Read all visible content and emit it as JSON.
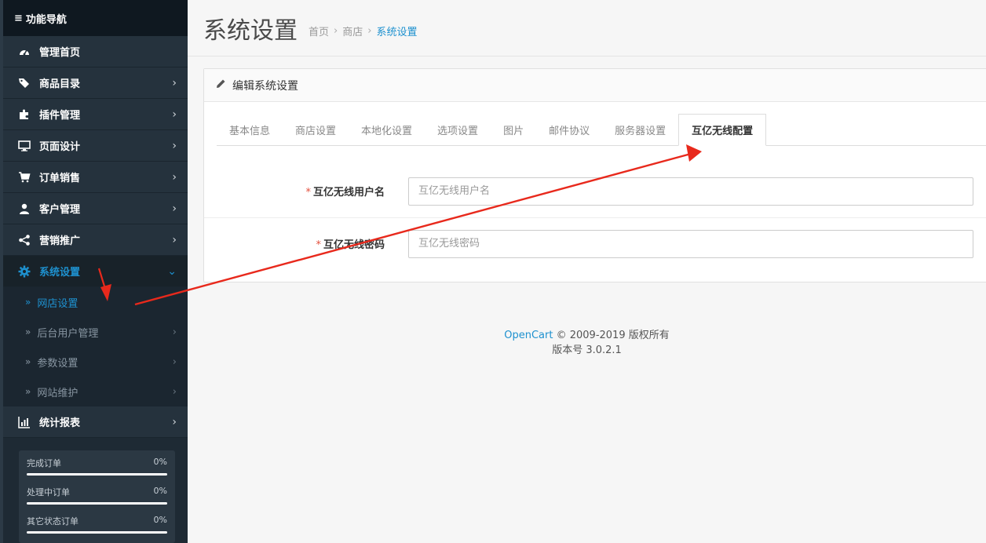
{
  "sidebar": {
    "header": "功能导航",
    "items": [
      {
        "label": "管理首页",
        "icon": "dashboard-icon",
        "chevron": ""
      },
      {
        "label": "商品目录",
        "icon": "tags-icon",
        "chevron": "›"
      },
      {
        "label": "插件管理",
        "icon": "puzzle-icon",
        "chevron": "›"
      },
      {
        "label": "页面设计",
        "icon": "desktop-icon",
        "chevron": "›"
      },
      {
        "label": "订单销售",
        "icon": "cart-icon",
        "chevron": "›"
      },
      {
        "label": "客户管理",
        "icon": "user-icon",
        "chevron": "›"
      },
      {
        "label": "营销推广",
        "icon": "share-icon",
        "chevron": "›"
      },
      {
        "label": "系统设置",
        "icon": "gear-icon",
        "chevron": "⌄"
      }
    ],
    "sub_items": [
      {
        "label": "网店设置",
        "marker": "»",
        "chevron": ""
      },
      {
        "label": "后台用户管理",
        "marker": "»",
        "chevron": "›"
      },
      {
        "label": "参数设置",
        "marker": "»",
        "chevron": "›"
      },
      {
        "label": "网站维护",
        "marker": "»",
        "chevron": "›"
      }
    ],
    "report_item": {
      "label": "统计报表",
      "icon": "bar-chart-icon",
      "chevron": "›"
    },
    "stats": [
      {
        "label": "完成订单",
        "value": "0%",
        "progress": 0
      },
      {
        "label": "处理中订单",
        "value": "0%",
        "progress": 0
      },
      {
        "label": "其它状态订单",
        "value": "0%",
        "progress": 0
      }
    ]
  },
  "header": {
    "title": "系统设置",
    "breadcrumb": [
      "首页",
      "商店",
      "系统设置"
    ],
    "separator": "›"
  },
  "panel": {
    "heading": "编辑系统设置",
    "tabs": [
      "基本信息",
      "商店设置",
      "本地化设置",
      "选项设置",
      "图片",
      "邮件协议",
      "服务器设置",
      "互亿无线配置"
    ],
    "active_tab": 7,
    "fields": [
      {
        "label": "互亿无线用户名",
        "placeholder": "互亿无线用户名",
        "value": "",
        "required": "*"
      },
      {
        "label": "互亿无线密码",
        "placeholder": "互亿无线密码",
        "value": "",
        "required": "*"
      }
    ]
  },
  "footer": {
    "brand": "OpenCart",
    "copyright": " © 2009-2019 版权所有",
    "version": "版本号 3.0.2.1"
  },
  "colors": {
    "accent": "#1e91cf",
    "sidebar_bg": "#1e2a34",
    "annotation_arrow": "#e8291c"
  }
}
